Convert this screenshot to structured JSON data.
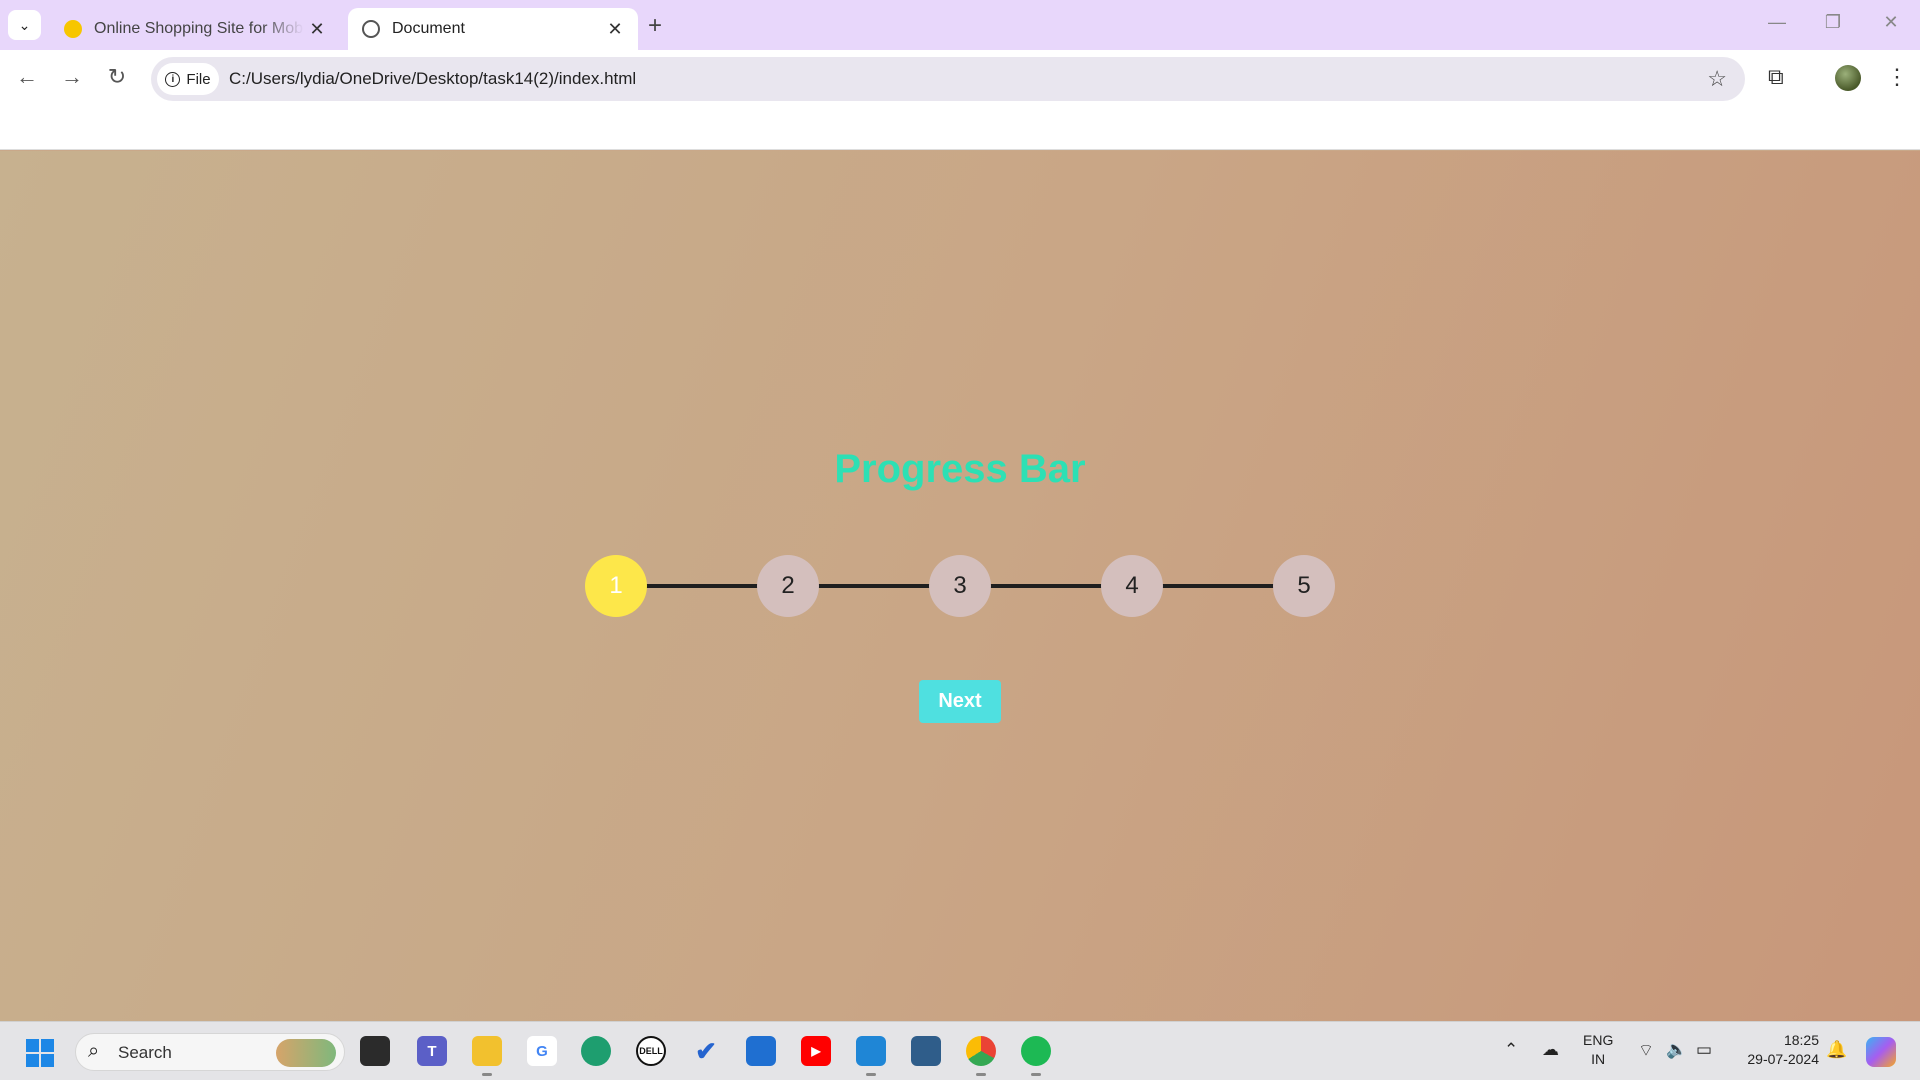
{
  "browser": {
    "tabs": [
      {
        "title": "Online Shopping Site for Mobile",
        "active": false
      },
      {
        "title": "Document",
        "active": true
      }
    ],
    "address": {
      "scheme_label": "File",
      "url": "C:/Users/lydia/OneDrive/Desktop/task14(2)/index.html"
    }
  },
  "page": {
    "title": "Progress Bar",
    "steps": [
      "1",
      "2",
      "3",
      "4",
      "5"
    ],
    "active_step": 1,
    "next_label": "Next",
    "colors": {
      "title": "#2de0b4",
      "active_step": "#fde74a",
      "inactive_step": "#d4bfbd",
      "button": "#4fe0e0"
    }
  },
  "taskbar": {
    "search_label": "Search",
    "language": {
      "line1": "ENG",
      "line2": "IN"
    },
    "clock": {
      "time": "18:25",
      "date": "29-07-2024"
    }
  }
}
